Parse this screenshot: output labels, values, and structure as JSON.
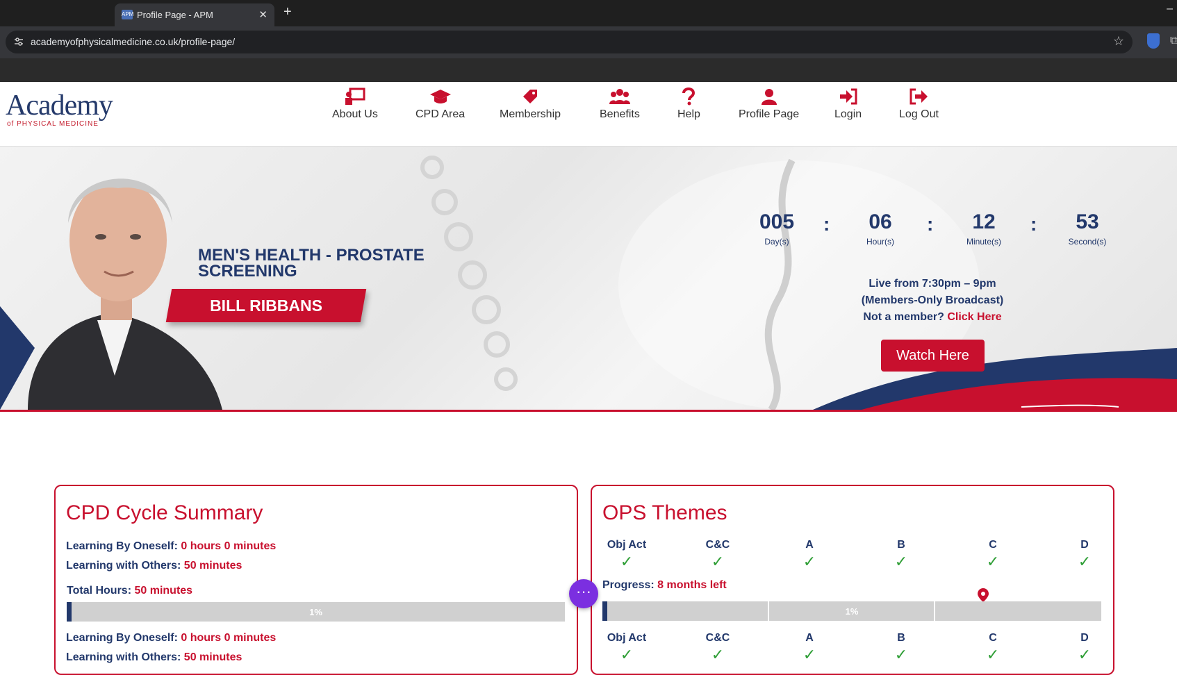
{
  "browser": {
    "tab_title": "Profile Page - APM",
    "tab_favicon": "APM",
    "close_glyph": "✕",
    "new_tab_glyph": "+",
    "url": "academyofphysicalmedicine.co.uk/profile-page/"
  },
  "logo": {
    "main": "Academy",
    "sub": "of PHYSICAL MEDICINE"
  },
  "nav": [
    {
      "label": "About Us",
      "icon": "presentation-icon"
    },
    {
      "label": "CPD Area",
      "icon": "graduation-cap-icon"
    },
    {
      "label": "Membership",
      "icon": "tag-icon"
    },
    {
      "label": "Benefits",
      "icon": "users-icon"
    },
    {
      "label": "Help",
      "icon": "question-icon"
    },
    {
      "label": "Profile Page",
      "icon": "user-icon"
    },
    {
      "label": "Login",
      "icon": "sign-in-icon"
    },
    {
      "label": "Log Out",
      "icon": "sign-out-icon"
    }
  ],
  "banner": {
    "headline_1": "MEN'S HEALTH - PROSTATE",
    "headline_2": "SCREENING",
    "speaker": "BILL RIBBANS",
    "countdown": [
      {
        "value": "005",
        "unit": "Day(s)"
      },
      {
        "value": "06",
        "unit": "Hour(s)"
      },
      {
        "value": "12",
        "unit": "Minute(s)"
      },
      {
        "value": "53",
        "unit": "Second(s)"
      }
    ],
    "separator": ":",
    "live_line1": "Live from 7:30pm – 9pm",
    "live_line2": "(Members-Only Broadcast)",
    "not_member": "Not a member?",
    "click_here": "Click Here",
    "watch_button": "Watch Here"
  },
  "cpd": {
    "title": "CPD Cycle Summary",
    "learning_oneself_label": "Learning By Oneself:",
    "learning_oneself_value": "0 hours 0 minutes",
    "learning_others_label": "Learning with Others:",
    "learning_others_value": "50 minutes",
    "total_label": "Total Hours:",
    "total_value": "50 minutes",
    "progress_text": "1%",
    "progress_fraction": 0.01,
    "learning_oneself_label_2": "Learning By Oneself:",
    "learning_oneself_value_2": "0 hours 0 minutes",
    "learning_others_label_2": "Learning with Others:",
    "learning_others_value_2": "50 minutes"
  },
  "ops": {
    "title": "OPS Themes",
    "headers": [
      "Obj Act",
      "C&C",
      "A",
      "B",
      "C",
      "D"
    ],
    "tick": "✓",
    "progress_label": "Progress:",
    "progress_value": "8 months left",
    "progress_text": "1%",
    "progress_fraction": 0.01
  },
  "colors": {
    "brand_red": "#c8102e",
    "brand_navy": "#22386b",
    "tick_green": "#2e9e35"
  }
}
